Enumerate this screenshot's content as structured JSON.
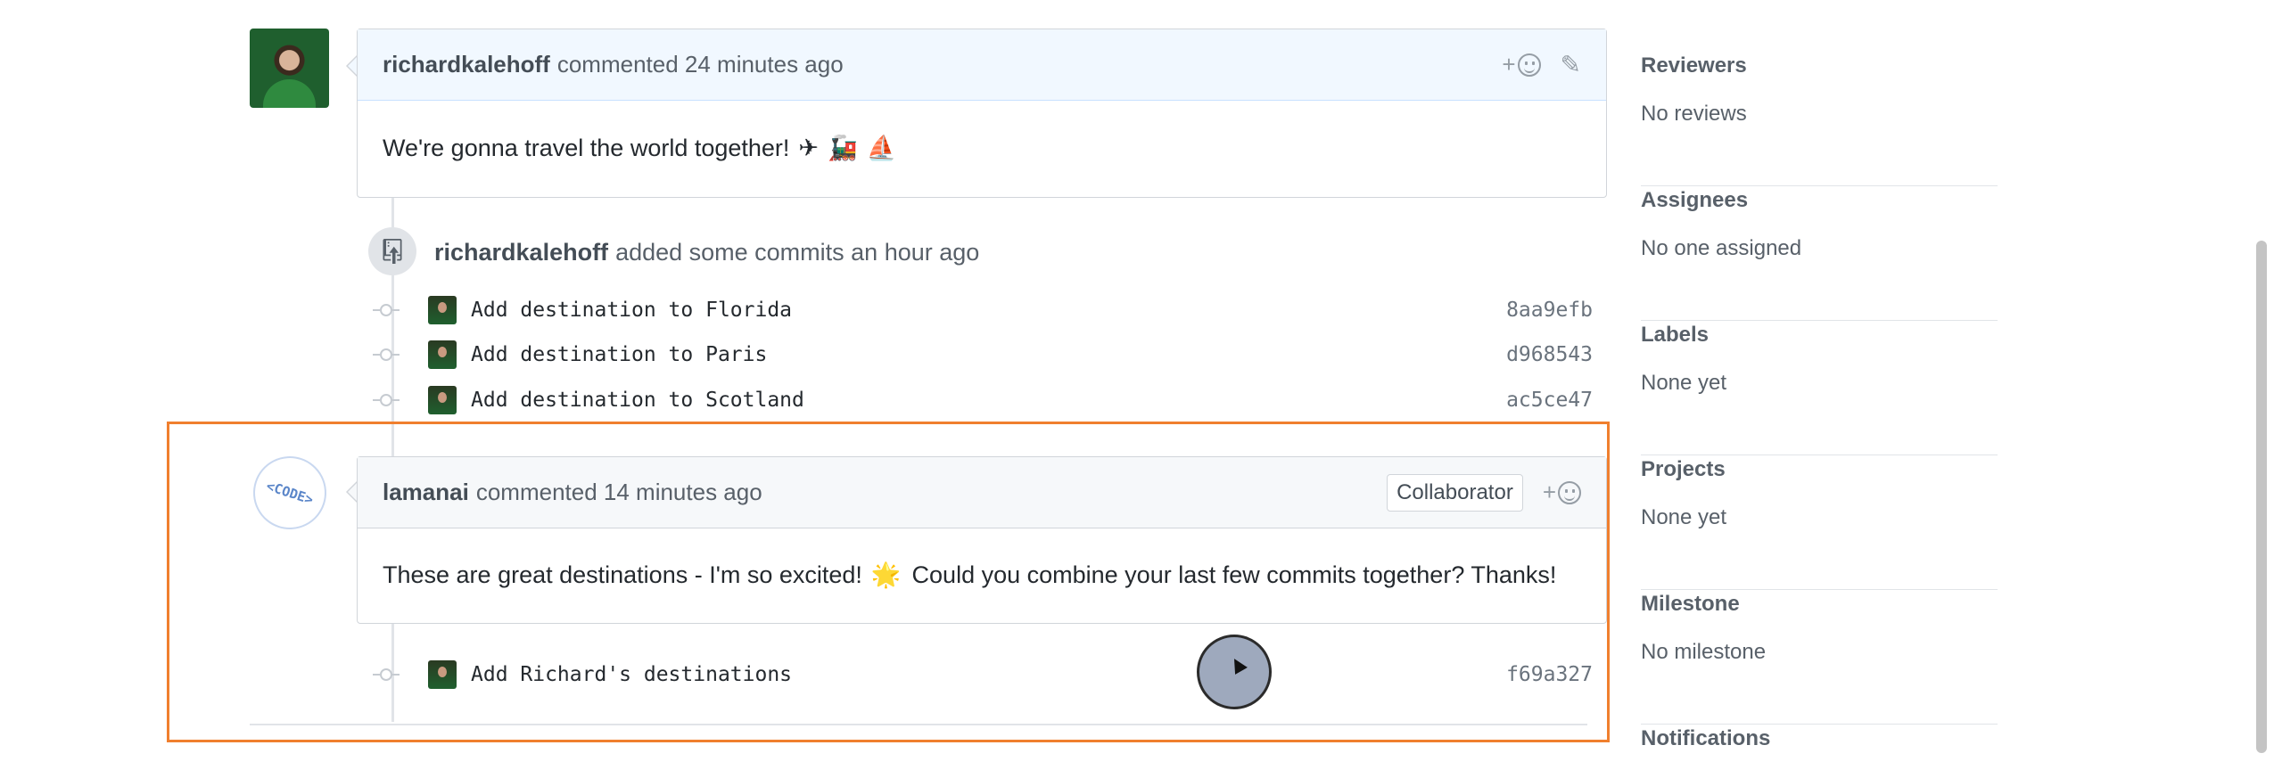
{
  "comment1": {
    "author": "richardkalehoff",
    "meta": "commented 24 minutes ago",
    "body": "We're gonna travel the world together!",
    "emojis": [
      "✈",
      "🚂",
      "⛵"
    ],
    "add_reaction": "+"
  },
  "event": {
    "author": "richardkalehoff",
    "meta": "added some commits an hour ago",
    "commits": [
      {
        "message": "Add destination to Florida",
        "sha": "8aa9efb"
      },
      {
        "message": "Add destination to Paris",
        "sha": "d968543"
      },
      {
        "message": "Add destination to Scotland",
        "sha": "ac5ce47"
      }
    ]
  },
  "comment2": {
    "author": "lamanai",
    "meta": "commented 14 minutes ago",
    "badge": "Collaborator",
    "body_part1": "These are great destinations - I'm so excited!",
    "emoji": "🌟",
    "body_part2": "Could you combine your last few commits together? Thanks!",
    "add_reaction": "+",
    "avatar_text": "<CODE>"
  },
  "followup_commit": {
    "message": "Add Richard's destinations",
    "sha": "f69a327"
  },
  "sidebar": [
    {
      "title": "Reviewers",
      "value": "No reviews"
    },
    {
      "title": "Assignees",
      "value": "No one assigned"
    },
    {
      "title": "Labels",
      "value": "None yet"
    },
    {
      "title": "Projects",
      "value": "None yet"
    },
    {
      "title": "Milestone",
      "value": "No milestone"
    },
    {
      "title": "Notifications",
      "value": ""
    }
  ],
  "colors": {
    "highlight": "#f07f2e",
    "link": "#0366d6"
  },
  "icons": {
    "reaction": "smiley-icon",
    "edit": "pencil-icon",
    "push": "repo-push-icon",
    "commit": "git-commit-icon"
  }
}
